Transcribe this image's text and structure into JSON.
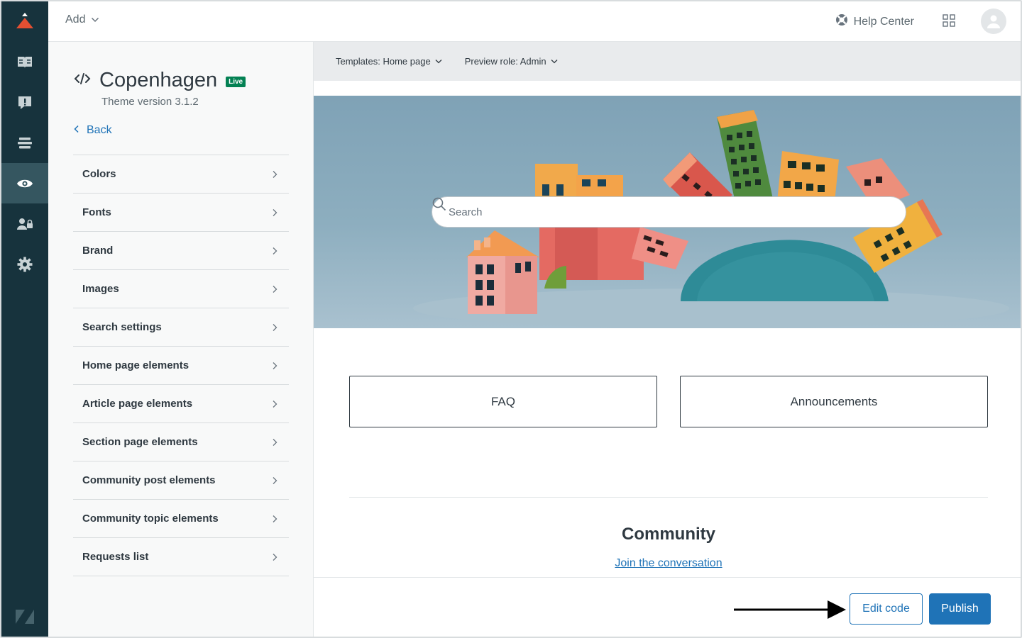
{
  "topbar": {
    "add_label": "Add",
    "help_center_label": "Help Center"
  },
  "theme": {
    "name": "Copenhagen",
    "badge": "Live",
    "version": "Theme version 3.1.2",
    "back_label": "Back"
  },
  "menu": {
    "items": [
      {
        "label": "Colors"
      },
      {
        "label": "Fonts"
      },
      {
        "label": "Brand"
      },
      {
        "label": "Images"
      },
      {
        "label": "Search settings"
      },
      {
        "label": "Home page elements"
      },
      {
        "label": "Article page elements"
      },
      {
        "label": "Section page elements"
      },
      {
        "label": "Community post elements"
      },
      {
        "label": "Community topic elements"
      },
      {
        "label": "Requests list"
      }
    ]
  },
  "preview": {
    "template_label": "Templates: Home page",
    "role_label": "Preview role: Admin",
    "search_placeholder": "Search",
    "categories": [
      {
        "label": "FAQ"
      },
      {
        "label": "Announcements"
      }
    ],
    "community_title": "Community",
    "community_link": "Join the conversation"
  },
  "footer": {
    "edit_code_label": "Edit code",
    "publish_label": "Publish"
  },
  "colors": {
    "rail_bg": "#17333d",
    "rail_active": "#355660",
    "accent_blue": "#1f73b7",
    "live_green": "#038153",
    "logo_red": "#e34f32"
  },
  "icons": {
    "rail": [
      "guide-icon",
      "ticket-alert-icon",
      "list-icon",
      "eye-icon",
      "user-lock-icon",
      "gear-icon"
    ]
  }
}
